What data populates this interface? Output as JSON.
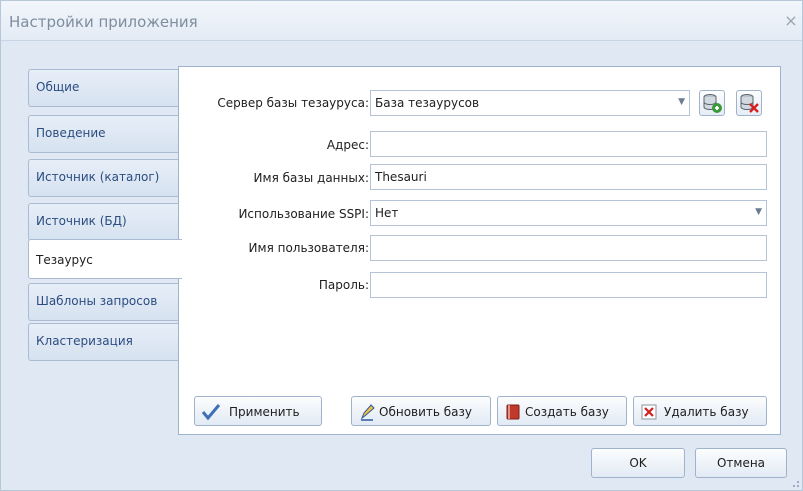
{
  "window": {
    "title": "Настройки приложения",
    "close_glyph": "×"
  },
  "tabs": [
    {
      "label": "Общие"
    },
    {
      "label": "Поведение"
    },
    {
      "label": "Источник (каталог)"
    },
    {
      "label": "Источник (БД)"
    },
    {
      "label": "Тезаурус",
      "active": true
    },
    {
      "label": "Шаблоны запросов"
    },
    {
      "label": "Кластеризация"
    }
  ],
  "form": {
    "server_label": "Сервер базы тезауруса:",
    "server_value": "База тезаурусов",
    "address_label": "Адрес:",
    "address_value": "",
    "dbname_label": "Имя базы данных:",
    "dbname_value": "Thesauri",
    "sspi_label": "Использование SSPI:",
    "sspi_value": "Нет",
    "user_label": "Имя пользователя:",
    "user_value": "",
    "password_label": "Пароль:",
    "password_value": ""
  },
  "actions": {
    "apply": "Применить",
    "refresh_db": "Обновить базу",
    "create_db": "Создать базу",
    "delete_db": "Удалить базу"
  },
  "footer": {
    "ok": "OK",
    "cancel": "Отмена"
  },
  "colors": {
    "accent": "#2b4d80",
    "apply_check": "#3f6fb6",
    "create_red": "#c0392b",
    "delete_red": "#d62020",
    "db_green": "#3a9a3a"
  }
}
